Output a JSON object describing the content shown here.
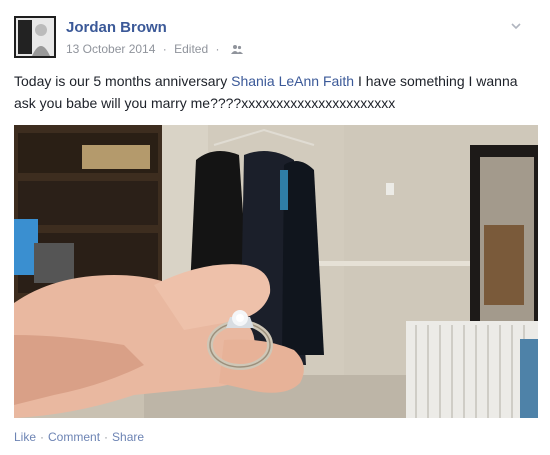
{
  "post": {
    "author_name": "Jordan Brown",
    "date": "13 October 2014",
    "separator": "·",
    "edited_label": "Edited",
    "audience_icon": "friends-icon",
    "text_part1": "Today is our 5 months anniversary ",
    "mention": "Shania LeAnn Faith",
    "text_part2": " I have something I wanna ask you babe will you marry me????xxxxxxxxxxxxxxxxxxxxxx"
  },
  "actions": {
    "like": "Like",
    "comment": "Comment",
    "share": "Share",
    "separator": "·"
  },
  "colors": {
    "link": "#3b5998",
    "meta": "#90949c",
    "action_link": "#6d84b4"
  }
}
